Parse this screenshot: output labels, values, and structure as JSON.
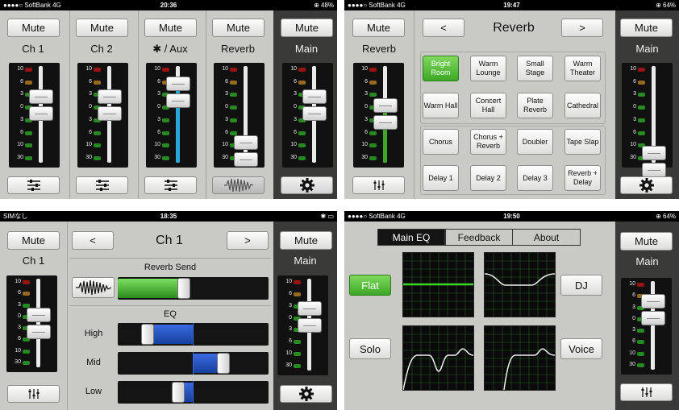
{
  "panel1": {
    "status": {
      "carrier": "●●●●○ SoftBank  4G",
      "time": "20:36",
      "battery": "⊕ ⁠48%"
    },
    "mute": "Mute",
    "channels": [
      "Ch 1",
      "Ch 2",
      "/ Aux",
      "Reverb",
      "Main"
    ],
    "ticks": [
      "10",
      "6",
      "3",
      "0",
      "3",
      "6",
      "10",
      "30"
    ]
  },
  "panel2": {
    "status": {
      "carrier": "●●●●○ SoftBank  4G",
      "time": "19:47",
      "battery": "⊕ 64%"
    },
    "mute": "Mute",
    "left_label": "Reverb",
    "right_label": "Main",
    "prev": "<",
    "next": ">",
    "title": "Reverb",
    "presets": [
      [
        "Bright Room",
        "Warm Lounge",
        "Small Stage",
        "Warm Theater"
      ],
      [
        "Warm Hall",
        "Concert Hall",
        "Plate Reverb",
        "Cathedral"
      ],
      [
        "Chorus",
        "Chorus + Reverb",
        "Doubler",
        "Tape Slap"
      ],
      [
        "Delay 1",
        "Delay 2",
        "Delay 3",
        "Reverb + Delay"
      ]
    ],
    "selected_preset": "Bright Room"
  },
  "panel3": {
    "status": {
      "carrier": "SIMなし",
      "time": "18:35",
      "battery": ""
    },
    "mute": "Mute",
    "left_label": "Ch 1",
    "right_label": "Main",
    "prev": "<",
    "next": ">",
    "title": "Ch 1",
    "reverb_send_label": "Reverb Send",
    "reverb_send_level": 0.45,
    "eq_label": "EQ",
    "bands": [
      {
        "label": "High",
        "value": 0.2
      },
      {
        "label": "Mid",
        "value": 0.7
      },
      {
        "label": "Low",
        "value": 0.4
      }
    ]
  },
  "panel4": {
    "status": {
      "carrier": "●●●●○ SoftBank  4G",
      "time": "19:50",
      "battery": "⊕ 64%"
    },
    "tabs": [
      "Main EQ",
      "Feedback",
      "About"
    ],
    "active_tab": "Main EQ",
    "presets": {
      "flat": "Flat",
      "solo": "Solo",
      "dj": "DJ",
      "voice": "Voice"
    },
    "mute": "Mute",
    "right_label": "Main"
  },
  "colors": {
    "accent_green": "#3da824",
    "aux_blue": "#2aa6d6",
    "eq_blue": "#1f4fb5",
    "panel_bg": "#c9c9c6",
    "main_col": "#3a3b38"
  }
}
